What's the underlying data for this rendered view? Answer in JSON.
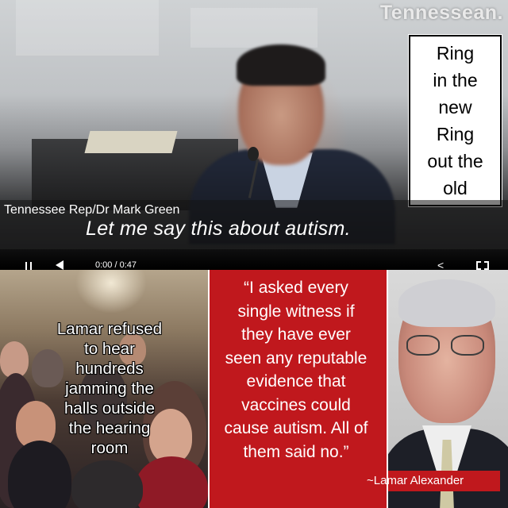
{
  "video": {
    "watermark": "Tennessean.",
    "speaker_name": "Tennessee Rep/Dr Mark Green",
    "caption": "Let me say this about autism.",
    "timecode": "0:00 / 0:47",
    "icons": [
      "pause-icon",
      "volume-icon",
      "share-icon",
      "fullscreen-icon"
    ]
  },
  "ring_box": {
    "lines": [
      "Ring",
      "in the",
      "new",
      "Ring",
      "out the",
      "old"
    ]
  },
  "crowd": {
    "lines": [
      "Lamar refused",
      "to hear",
      "hundreds",
      "jamming the",
      "halls outside",
      "the hearing",
      "room"
    ]
  },
  "quote": {
    "lines": [
      "“I asked every",
      "single witness if",
      "they have ever",
      "seen any reputable",
      "evidence that",
      "vaccines could",
      "cause autism. All of",
      "them said no.”"
    ],
    "attribution": "~Lamar Alexander",
    "panel_color": "#c0181d"
  }
}
